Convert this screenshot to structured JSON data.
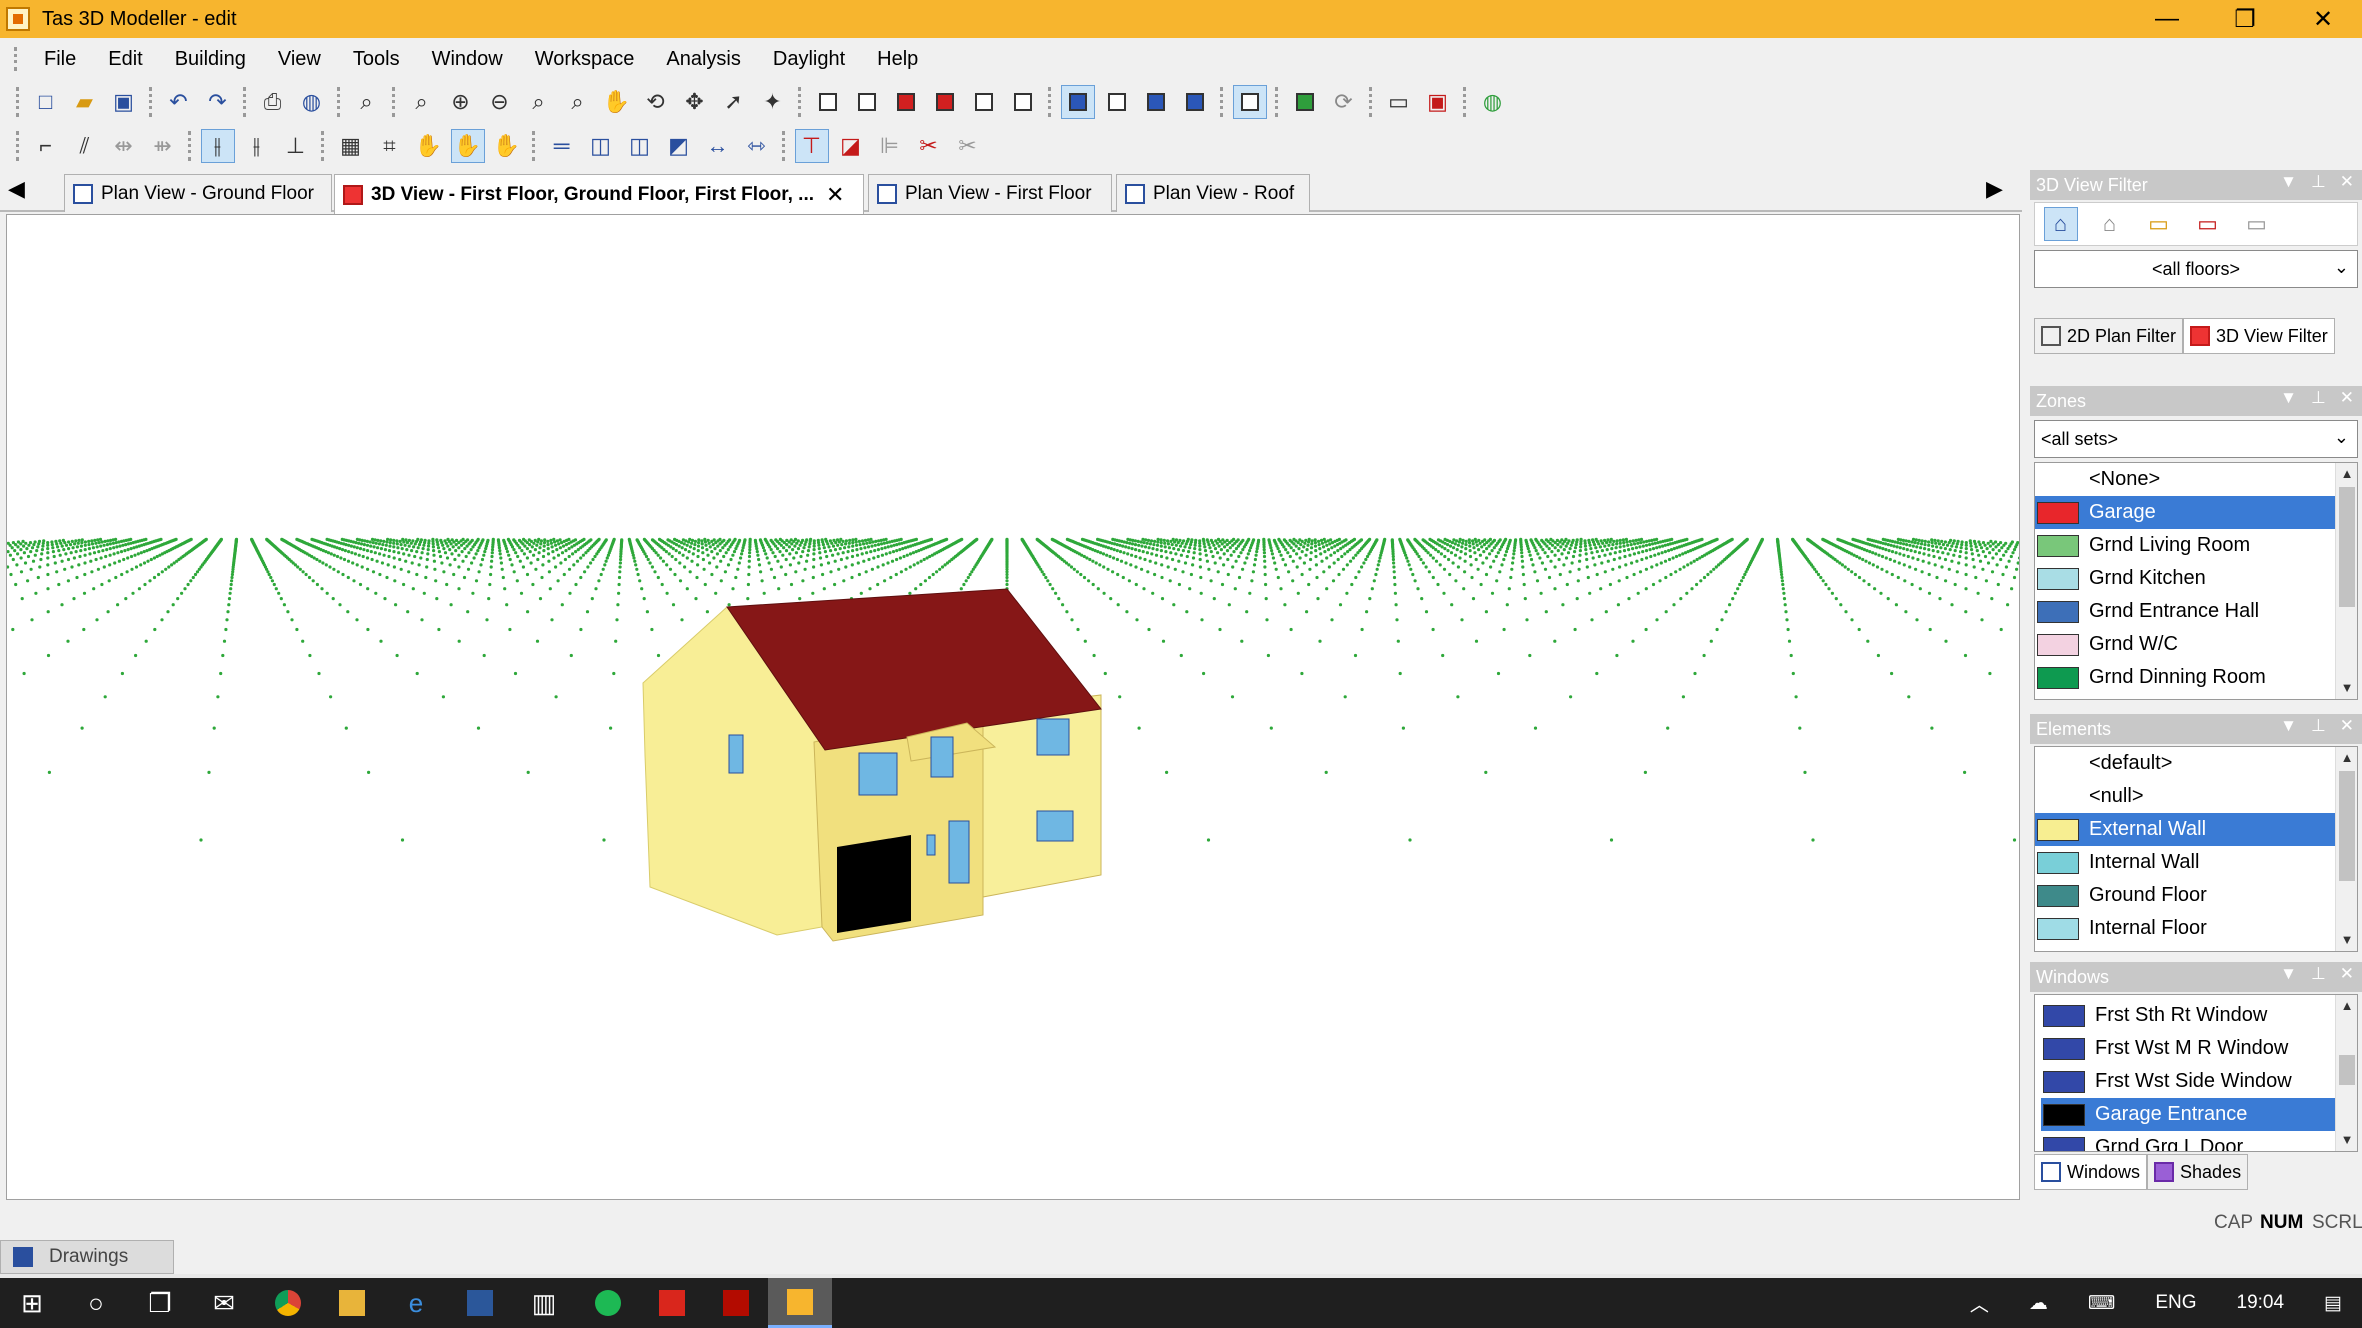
{
  "window": {
    "title": "Tas 3D Modeller - edit",
    "controls": [
      "—",
      "❐",
      "✕"
    ]
  },
  "menu": [
    "File",
    "Edit",
    "Building",
    "View",
    "Tools",
    "Window",
    "Workspace",
    "Analysis",
    "Daylight",
    "Help"
  ],
  "tabs": {
    "prev_arrow": "◀",
    "next_arrow": "▶",
    "items": [
      {
        "label": "Plan View - Ground Floor",
        "active": false
      },
      {
        "label": "3D View - First Floor, Ground Floor, First Floor, ...",
        "active": true
      },
      {
        "label": "Plan View - First Floor",
        "active": false
      },
      {
        "label": "Plan View - Roof",
        "active": false
      }
    ],
    "close": "✕"
  },
  "panel_3d_filter": {
    "title": "3D View Filter",
    "floor_select": "<all floors>",
    "tab_2d": "2D Plan Filter",
    "tab_3d": "3D View Filter"
  },
  "panel_zones": {
    "title": "Zones",
    "set_select": "<all sets>",
    "items": [
      {
        "label": "<None>",
        "color": "",
        "selected": false
      },
      {
        "label": "Garage",
        "color": "#e8262b",
        "selected": true
      },
      {
        "label": "Grnd Living Room",
        "color": "#79c77a",
        "selected": false
      },
      {
        "label": "Grnd Kitchen",
        "color": "#a9dde5",
        "selected": false
      },
      {
        "label": "Grnd Entrance Hall",
        "color": "#3d6fb8",
        "selected": false
      },
      {
        "label": "Grnd W/C",
        "color": "#f3d2e1",
        "selected": false
      },
      {
        "label": "Grnd Dinning Room",
        "color": "#0e9a50",
        "selected": false
      }
    ]
  },
  "panel_elements": {
    "title": "Elements",
    "items": [
      {
        "label": "<default>",
        "color": "",
        "selected": false
      },
      {
        "label": "<null>",
        "color": "",
        "selected": false
      },
      {
        "label": "External Wall",
        "color": "#f7ee91",
        "selected": true
      },
      {
        "label": "Internal Wall",
        "color": "#79cfd8",
        "selected": false
      },
      {
        "label": "Ground Floor",
        "color": "#3e8a8a",
        "selected": false
      },
      {
        "label": "Internal Floor",
        "color": "#9fdce6",
        "selected": false
      }
    ]
  },
  "panel_windows": {
    "title": "Windows",
    "items": [
      {
        "label": "Frst Sth Rt Window",
        "color": "#3248a8",
        "selected": false
      },
      {
        "label": "Frst Wst M R Window",
        "color": "#3248a8",
        "selected": false
      },
      {
        "label": "Frst Wst Side Window",
        "color": "#3248a8",
        "selected": false
      },
      {
        "label": "Garage Entrance",
        "color": "#000000",
        "selected": true
      },
      {
        "label": "Grnd Grg L Door",
        "color": "#3248a8",
        "selected": false
      }
    ],
    "tab_windows": "Windows",
    "tab_shades": "Shades"
  },
  "status": {
    "cap": "CAP",
    "num": "NUM",
    "scrl": "SCRL"
  },
  "drawings_tab": "Drawings",
  "taskbar": {
    "lang": "ENG",
    "time": "19:04"
  },
  "colors": {
    "titlebar": "#f7b52e",
    "selection": "#3a7bd5",
    "wall": "#f7ee91",
    "roof": "#8b1a1a",
    "grid_dots": "#2ea83a"
  }
}
